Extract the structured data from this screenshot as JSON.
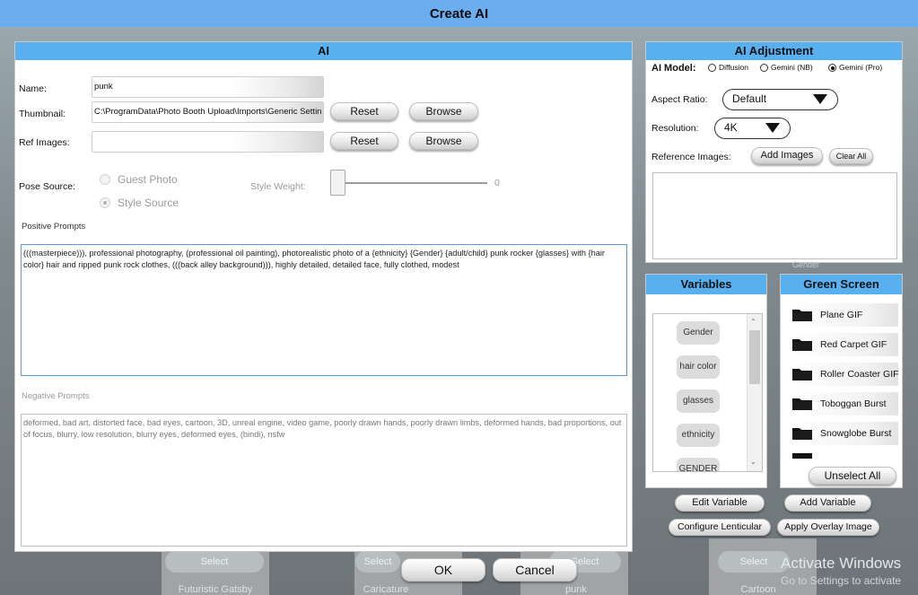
{
  "window": {
    "title": "Create AI"
  },
  "ai_panel": {
    "header": "AI",
    "name_label": "Name:",
    "name_value": "punk",
    "thumbnail_label": "Thumbnail:",
    "thumbnail_value": "C:\\ProgramData\\Photo Booth Upload\\Imports\\Generic Settin",
    "ref_images_label": "Ref Images:",
    "ref_images_value": "",
    "reset_label": "Reset",
    "browse_label": "Browse",
    "pose_source_label": "Pose Source:",
    "pose_options": [
      "Guest Photo",
      "Style Source"
    ],
    "pose_selected": "Style Source",
    "style_weight_label": "Style Weight:",
    "style_weight_value": "0",
    "positive_label": "Positive Prompts",
    "positive_text": "(((masterpiece))), professional photography, (professional oil painting), photorealistic photo of a {ethnicity} {Gender} {adult/child} punk rocker {glasses} with {hair color} hair and ripped punk rock clothes, (((back alley background))), highly detailed, detailed face, fully clothed, modest",
    "negative_label": "Negative Prompts",
    "negative_text": "deformed, bad art, distorted face, bad eyes, cartoon, 3D, unreal engine, video game, poorly drawn hands, poorly drawn limbs, deformed hands, bad proportions, out of focus, blurry, low resolution, blurry eyes, deformed eyes, (bindi), nsfw"
  },
  "adjust_panel": {
    "header": "AI Adjustment",
    "model_label": "AI Model:",
    "model_options": [
      "Diffusion",
      "Gemini (NB)",
      "Gemini (Pro)"
    ],
    "model_selected": "Gemini (Pro)",
    "aspect_label": "Aspect Ratio:",
    "aspect_value": "Default",
    "resolution_label": "Resolution:",
    "resolution_value": "4K",
    "ref_images_label": "Reference Images:",
    "add_images_label": "Add Images",
    "clear_all_label": "Clear All"
  },
  "variables": {
    "header": "Variables",
    "items": [
      "Gender",
      "hair color",
      "glasses",
      "ethnicity",
      "GENDER"
    ]
  },
  "green_screen": {
    "header": "Green Screen",
    "items": [
      "Plane GIF",
      "Red Carpet GIF",
      "Roller Coaster GIF",
      "Toboggan Burst",
      "Snowglobe Burst"
    ],
    "unselect_all_label": "Unselect All"
  },
  "actions": {
    "edit_variable": "Edit Variable",
    "add_variable": "Add Variable",
    "configure_lenticular": "Configure Lenticular",
    "apply_overlay": "Apply Overlay Image",
    "ok": "OK",
    "cancel": "Cancel"
  },
  "background": {
    "select_label": "Select",
    "tile_labels": [
      "Futuristic Gatsby",
      "Caricature",
      "punk",
      "Cartoon"
    ],
    "gender_hint": "Gender",
    "activate_title": "Activate Windows",
    "activate_sub": "Go to Settings to activate"
  },
  "colors": {
    "title_bar": "#6aaef0",
    "panel_header": "#58b0ef",
    "window_bg": "#7d8c93"
  }
}
